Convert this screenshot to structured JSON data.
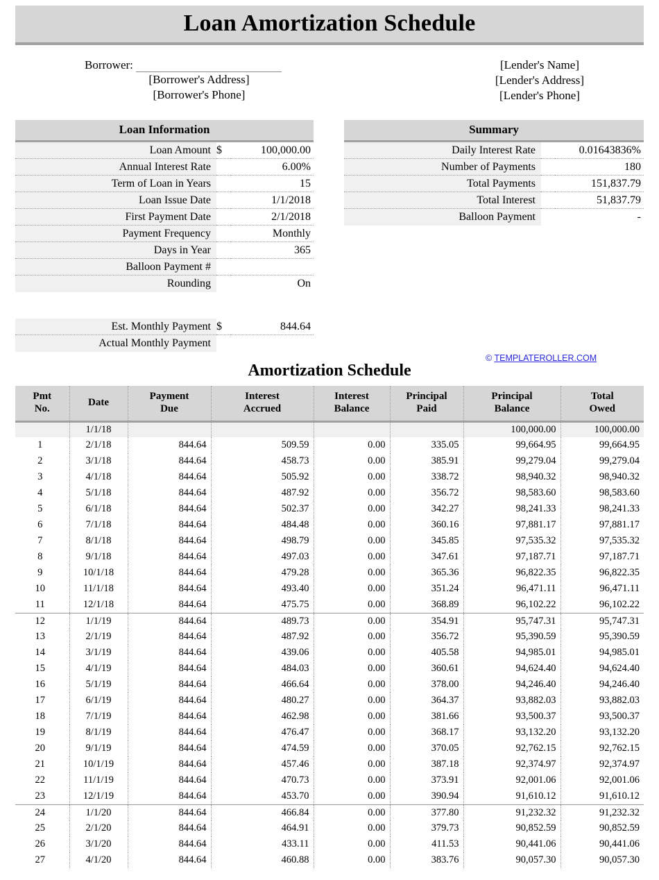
{
  "document": {
    "title": "Loan Amortization Schedule"
  },
  "parties": {
    "borrower_label": "Borrower:",
    "borrower_address": "[Borrower's Address]",
    "borrower_phone": "[Borrower's Phone]",
    "lender_name": "[Lender's Name]",
    "lender_address": "[Lender's Address]",
    "lender_phone": "[Lender's Phone]"
  },
  "loan_information": {
    "heading": "Loan Information",
    "rows": [
      {
        "label": "Loan Amount",
        "currency": "$",
        "value": "100,000.00"
      },
      {
        "label": "Annual Interest Rate",
        "currency": "",
        "value": "6.00%"
      },
      {
        "label": "Term of Loan in Years",
        "currency": "",
        "value": "15"
      },
      {
        "label": "Loan Issue Date",
        "currency": "",
        "value": "1/1/2018"
      },
      {
        "label": "First Payment Date",
        "currency": "",
        "value": "2/1/2018"
      },
      {
        "label": "Payment Frequency",
        "currency": "",
        "value": "Monthly"
      },
      {
        "label": "Days in Year",
        "currency": "",
        "value": "365"
      },
      {
        "label": "Balloon Payment #",
        "currency": "",
        "value": ""
      },
      {
        "label": "Rounding",
        "currency": "",
        "value": "On"
      }
    ]
  },
  "summary": {
    "heading": "Summary",
    "rows": [
      {
        "label": "Daily Interest Rate",
        "currency": "",
        "value": "0.01643836%"
      },
      {
        "label": "Number of Payments",
        "currency": "",
        "value": "180"
      },
      {
        "label": "Total Payments",
        "currency": "",
        "value": "151,837.79"
      },
      {
        "label": "Total Interest",
        "currency": "",
        "value": "51,837.79"
      },
      {
        "label": "Balloon Payment",
        "currency": "",
        "value": "-"
      }
    ]
  },
  "payment_block": {
    "rows": [
      {
        "label": "Est. Monthly Payment",
        "currency": "$",
        "value": "844.64"
      },
      {
        "label": "Actual Monthly Payment",
        "currency": "",
        "value": ""
      }
    ]
  },
  "watermark": {
    "copyright": "©",
    "site": "TEMPLATEROLLER.COM",
    "color": "#2626d6"
  },
  "schedule": {
    "title": "Amortization Schedule",
    "columns": [
      "Pmt No.",
      "Date",
      "Payment Due",
      "Interest Accrued",
      "Interest Balance",
      "Principal Paid",
      "Principal Balance",
      "Total Owed"
    ],
    "column_lines": [
      [
        "Pmt",
        "No."
      ],
      [
        "Date",
        ""
      ],
      [
        "Payment",
        "Due"
      ],
      [
        "Interest",
        "Accrued"
      ],
      [
        "Interest",
        "Balance"
      ],
      [
        "Principal",
        "Paid"
      ],
      [
        "Principal",
        "Balance"
      ],
      [
        "Total",
        "Owed"
      ]
    ],
    "rows": [
      {
        "pmt": "",
        "date": "1/1/18",
        "payment_due": "",
        "interest_accrued": "",
        "interest_balance": "",
        "principal_paid": "",
        "principal_balance": "100,000.00",
        "total_owed": "100,000.00",
        "initial": true,
        "year_start": false
      },
      {
        "pmt": "1",
        "date": "2/1/18",
        "payment_due": "844.64",
        "interest_accrued": "509.59",
        "interest_balance": "0.00",
        "principal_paid": "335.05",
        "principal_balance": "99,664.95",
        "total_owed": "99,664.95",
        "initial": false,
        "year_start": false
      },
      {
        "pmt": "2",
        "date": "3/1/18",
        "payment_due": "844.64",
        "interest_accrued": "458.73",
        "interest_balance": "0.00",
        "principal_paid": "385.91",
        "principal_balance": "99,279.04",
        "total_owed": "99,279.04",
        "initial": false,
        "year_start": false
      },
      {
        "pmt": "3",
        "date": "4/1/18",
        "payment_due": "844.64",
        "interest_accrued": "505.92",
        "interest_balance": "0.00",
        "principal_paid": "338.72",
        "principal_balance": "98,940.32",
        "total_owed": "98,940.32",
        "initial": false,
        "year_start": false
      },
      {
        "pmt": "4",
        "date": "5/1/18",
        "payment_due": "844.64",
        "interest_accrued": "487.92",
        "interest_balance": "0.00",
        "principal_paid": "356.72",
        "principal_balance": "98,583.60",
        "total_owed": "98,583.60",
        "initial": false,
        "year_start": false
      },
      {
        "pmt": "5",
        "date": "6/1/18",
        "payment_due": "844.64",
        "interest_accrued": "502.37",
        "interest_balance": "0.00",
        "principal_paid": "342.27",
        "principal_balance": "98,241.33",
        "total_owed": "98,241.33",
        "initial": false,
        "year_start": false
      },
      {
        "pmt": "6",
        "date": "7/1/18",
        "payment_due": "844.64",
        "interest_accrued": "484.48",
        "interest_balance": "0.00",
        "principal_paid": "360.16",
        "principal_balance": "97,881.17",
        "total_owed": "97,881.17",
        "initial": false,
        "year_start": false
      },
      {
        "pmt": "7",
        "date": "8/1/18",
        "payment_due": "844.64",
        "interest_accrued": "498.79",
        "interest_balance": "0.00",
        "principal_paid": "345.85",
        "principal_balance": "97,535.32",
        "total_owed": "97,535.32",
        "initial": false,
        "year_start": false
      },
      {
        "pmt": "8",
        "date": "9/1/18",
        "payment_due": "844.64",
        "interest_accrued": "497.03",
        "interest_balance": "0.00",
        "principal_paid": "347.61",
        "principal_balance": "97,187.71",
        "total_owed": "97,187.71",
        "initial": false,
        "year_start": false
      },
      {
        "pmt": "9",
        "date": "10/1/18",
        "payment_due": "844.64",
        "interest_accrued": "479.28",
        "interest_balance": "0.00",
        "principal_paid": "365.36",
        "principal_balance": "96,822.35",
        "total_owed": "96,822.35",
        "initial": false,
        "year_start": false
      },
      {
        "pmt": "10",
        "date": "11/1/18",
        "payment_due": "844.64",
        "interest_accrued": "493.40",
        "interest_balance": "0.00",
        "principal_paid": "351.24",
        "principal_balance": "96,471.11",
        "total_owed": "96,471.11",
        "initial": false,
        "year_start": false
      },
      {
        "pmt": "11",
        "date": "12/1/18",
        "payment_due": "844.64",
        "interest_accrued": "475.75",
        "interest_balance": "0.00",
        "principal_paid": "368.89",
        "principal_balance": "96,102.22",
        "total_owed": "96,102.22",
        "initial": false,
        "year_start": false
      },
      {
        "pmt": "12",
        "date": "1/1/19",
        "payment_due": "844.64",
        "interest_accrued": "489.73",
        "interest_balance": "0.00",
        "principal_paid": "354.91",
        "principal_balance": "95,747.31",
        "total_owed": "95,747.31",
        "initial": false,
        "year_start": true
      },
      {
        "pmt": "13",
        "date": "2/1/19",
        "payment_due": "844.64",
        "interest_accrued": "487.92",
        "interest_balance": "0.00",
        "principal_paid": "356.72",
        "principal_balance": "95,390.59",
        "total_owed": "95,390.59",
        "initial": false,
        "year_start": false
      },
      {
        "pmt": "14",
        "date": "3/1/19",
        "payment_due": "844.64",
        "interest_accrued": "439.06",
        "interest_balance": "0.00",
        "principal_paid": "405.58",
        "principal_balance": "94,985.01",
        "total_owed": "94,985.01",
        "initial": false,
        "year_start": false
      },
      {
        "pmt": "15",
        "date": "4/1/19",
        "payment_due": "844.64",
        "interest_accrued": "484.03",
        "interest_balance": "0.00",
        "principal_paid": "360.61",
        "principal_balance": "94,624.40",
        "total_owed": "94,624.40",
        "initial": false,
        "year_start": false
      },
      {
        "pmt": "16",
        "date": "5/1/19",
        "payment_due": "844.64",
        "interest_accrued": "466.64",
        "interest_balance": "0.00",
        "principal_paid": "378.00",
        "principal_balance": "94,246.40",
        "total_owed": "94,246.40",
        "initial": false,
        "year_start": false
      },
      {
        "pmt": "17",
        "date": "6/1/19",
        "payment_due": "844.64",
        "interest_accrued": "480.27",
        "interest_balance": "0.00",
        "principal_paid": "364.37",
        "principal_balance": "93,882.03",
        "total_owed": "93,882.03",
        "initial": false,
        "year_start": false
      },
      {
        "pmt": "18",
        "date": "7/1/19",
        "payment_due": "844.64",
        "interest_accrued": "462.98",
        "interest_balance": "0.00",
        "principal_paid": "381.66",
        "principal_balance": "93,500.37",
        "total_owed": "93,500.37",
        "initial": false,
        "year_start": false
      },
      {
        "pmt": "19",
        "date": "8/1/19",
        "payment_due": "844.64",
        "interest_accrued": "476.47",
        "interest_balance": "0.00",
        "principal_paid": "368.17",
        "principal_balance": "93,132.20",
        "total_owed": "93,132.20",
        "initial": false,
        "year_start": false
      },
      {
        "pmt": "20",
        "date": "9/1/19",
        "payment_due": "844.64",
        "interest_accrued": "474.59",
        "interest_balance": "0.00",
        "principal_paid": "370.05",
        "principal_balance": "92,762.15",
        "total_owed": "92,762.15",
        "initial": false,
        "year_start": false
      },
      {
        "pmt": "21",
        "date": "10/1/19",
        "payment_due": "844.64",
        "interest_accrued": "457.46",
        "interest_balance": "0.00",
        "principal_paid": "387.18",
        "principal_balance": "92,374.97",
        "total_owed": "92,374.97",
        "initial": false,
        "year_start": false
      },
      {
        "pmt": "22",
        "date": "11/1/19",
        "payment_due": "844.64",
        "interest_accrued": "470.73",
        "interest_balance": "0.00",
        "principal_paid": "373.91",
        "principal_balance": "92,001.06",
        "total_owed": "92,001.06",
        "initial": false,
        "year_start": false
      },
      {
        "pmt": "23",
        "date": "12/1/19",
        "payment_due": "844.64",
        "interest_accrued": "453.70",
        "interest_balance": "0.00",
        "principal_paid": "390.94",
        "principal_balance": "91,610.12",
        "total_owed": "91,610.12",
        "initial": false,
        "year_start": false
      },
      {
        "pmt": "24",
        "date": "1/1/20",
        "payment_due": "844.64",
        "interest_accrued": "466.84",
        "interest_balance": "0.00",
        "principal_paid": "377.80",
        "principal_balance": "91,232.32",
        "total_owed": "91,232.32",
        "initial": false,
        "year_start": true
      },
      {
        "pmt": "25",
        "date": "2/1/20",
        "payment_due": "844.64",
        "interest_accrued": "464.91",
        "interest_balance": "0.00",
        "principal_paid": "379.73",
        "principal_balance": "90,852.59",
        "total_owed": "90,852.59",
        "initial": false,
        "year_start": false
      },
      {
        "pmt": "26",
        "date": "3/1/20",
        "payment_due": "844.64",
        "interest_accrued": "433.11",
        "interest_balance": "0.00",
        "principal_paid": "411.53",
        "principal_balance": "90,441.06",
        "total_owed": "90,441.06",
        "initial": false,
        "year_start": false
      },
      {
        "pmt": "27",
        "date": "4/1/20",
        "payment_due": "844.64",
        "interest_accrued": "460.88",
        "interest_balance": "0.00",
        "principal_paid": "383.76",
        "principal_balance": "90,057.30",
        "total_owed": "90,057.30",
        "initial": false,
        "year_start": false
      }
    ]
  }
}
